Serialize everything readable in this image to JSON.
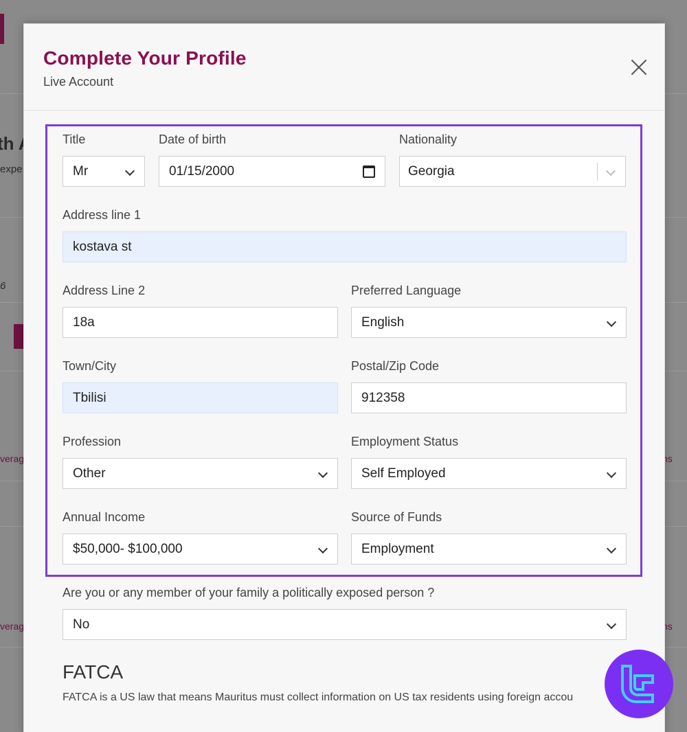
{
  "background": {
    "heading_fragment": "th A",
    "subtext_fragment": "expe",
    "number_fragment": "6",
    "leverage_fragment_1": "verag",
    "leverage_fragment_2": "verag",
    "right_fragment_1": "ns",
    "right_fragment_2": "ns"
  },
  "modal": {
    "title": "Complete Your Profile",
    "subtitle": "Live Account",
    "close_icon": "close-icon"
  },
  "form": {
    "title": {
      "label": "Title",
      "value": "Mr"
    },
    "dob": {
      "label": "Date of birth",
      "value": "01/15/2000"
    },
    "nationality": {
      "label": "Nationality",
      "value": "Georgia"
    },
    "address1": {
      "label": "Address line 1",
      "value": "kostava st"
    },
    "address2": {
      "label": "Address Line 2",
      "value": "18a"
    },
    "language": {
      "label": "Preferred Language",
      "value": "English"
    },
    "city": {
      "label": "Town/City",
      "value": "Tbilisi"
    },
    "postal": {
      "label": "Postal/Zip Code",
      "value": "912358"
    },
    "profession": {
      "label": "Profession",
      "value": "Other"
    },
    "employment": {
      "label": "Employment Status",
      "value": "Self Employed"
    },
    "income": {
      "label": "Annual Income",
      "value": "$50,000- $100,000"
    },
    "funds": {
      "label": "Source of Funds",
      "value": "Employment"
    },
    "pep": {
      "label": "Are you or any member of your family a politically exposed person ?",
      "value": "No"
    }
  },
  "fatca": {
    "title": "FATCA",
    "text": "FATCA is a US law that means Mauritus must collect information on US tax residents using foreign accou"
  },
  "colors": {
    "title": "#8b1050",
    "highlight": "#7a3cdc",
    "autofill": "#e8f0fd",
    "badge": "#7b2ff2"
  }
}
